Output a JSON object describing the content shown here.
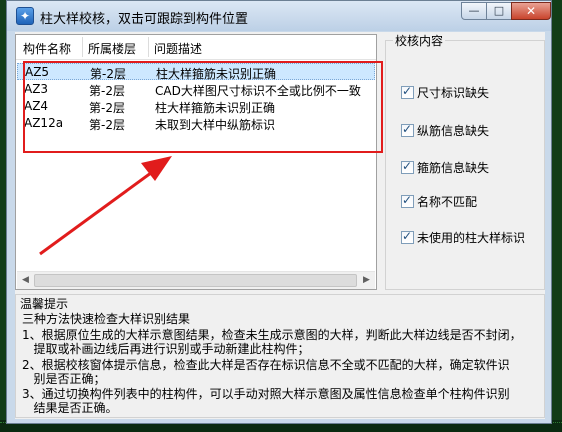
{
  "window": {
    "title": "柱大样校核，双击可跟踪到构件位置",
    "min_symbol": "—",
    "max_symbol": "□",
    "close_symbol": "✕"
  },
  "table": {
    "headers": [
      "构件名称",
      "所属楼层",
      "问题描述"
    ],
    "rows": [
      {
        "name": "AZ5",
        "floor": "第-2层",
        "problem": "柱大样箍筋未识别正确"
      },
      {
        "name": "AZ3",
        "floor": "第-2层",
        "problem": "CAD大样图尺寸标识不全或比例不一致"
      },
      {
        "name": "AZ4",
        "floor": "第-2层",
        "problem": "柱大样箍筋未识别正确"
      },
      {
        "name": "AZ12a",
        "floor": "第-2层",
        "problem": "未取到大样中纵筋标识"
      }
    ]
  },
  "check_group": {
    "title": "校核内容",
    "items": [
      {
        "label": "尺寸标识缺失",
        "checked": true
      },
      {
        "label": "纵筋信息缺失",
        "checked": true
      },
      {
        "label": "箍筋信息缺失",
        "checked": true
      },
      {
        "label": "名称不匹配",
        "checked": true
      },
      {
        "label": "未使用的柱大样标识",
        "checked": true
      }
    ]
  },
  "tips": {
    "title": "温馨提示",
    "lines": [
      "三种方法快速检查大样识别结果",
      "1、根据原位生成的大样示意图结果，检查未生成示意图的大样，判断此大样边线是否不封闭，",
      "   提取或补画边线后再进行识别或手动新建此柱构件；",
      "2、根据校核窗体提示信息，检查此大样是否存在标识信息不全或不匹配的大样，确定软件识",
      "   别是否正确；",
      "3、通过切换构件列表中的柱构件，可以手动对照大样示意图及属性信息检查单个柱构件识别",
      "   结果是否正确。"
    ]
  },
  "colors": {
    "highlight": "#e11c1c",
    "selection": "#cde8ff"
  }
}
